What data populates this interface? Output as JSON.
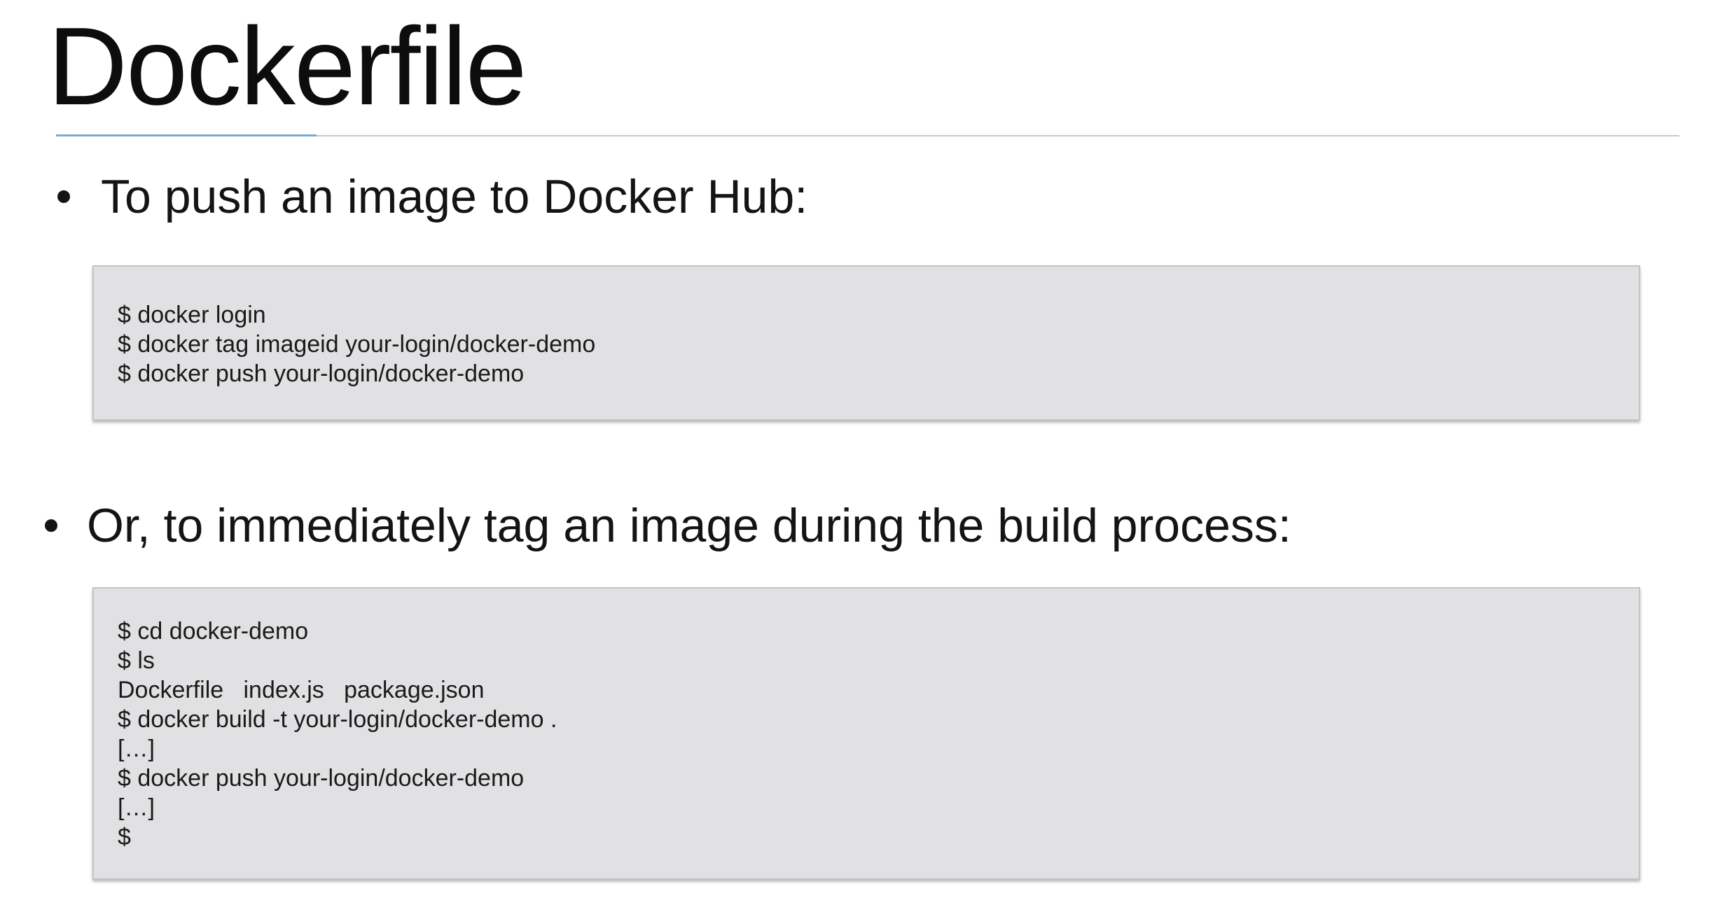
{
  "slide": {
    "title": "Dockerfile"
  },
  "sections": [
    {
      "bullet": "To push an image to Docker Hub:",
      "code_lines": [
        "$ docker login",
        "$ docker tag imageid your-login/docker-demo",
        "$ docker push your-login/docker-demo"
      ]
    },
    {
      "bullet": "Or, to immediately tag an image during the build process:",
      "code_lines": [
        "$ cd docker-demo",
        "$ ls",
        "Dockerfile   index.js   package.json",
        "$ docker build -t your-login/docker-demo .",
        "[…]",
        "$ docker push your-login/docker-demo",
        "[…]",
        "$"
      ]
    }
  ],
  "colors": {
    "title_rule": "#c8c8c8",
    "title_rule_accent": "#7aa9d6",
    "code_background": "#e1e1e3"
  }
}
